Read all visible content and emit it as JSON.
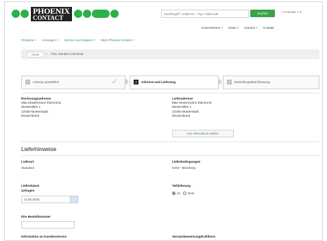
{
  "header": {
    "brand_line1": "PHOENIX",
    "brand_line2": "CONTACT",
    "search_placeholder": "Suchbegriff / Artikel-Nr. / Typ / Webcode",
    "search_button": "Suchen",
    "product_link": "> Produkte A-Z",
    "colors": {
      "brand_green": "#2bb04a",
      "accent_green": "#3da24a"
    }
  },
  "subnav": [
    "Unternehmen",
    "News",
    "Karriere",
    "Kontakt"
  ],
  "mainnav": [
    "Produkte",
    "Lösungen",
    "Service und Support",
    "Mein Phoenix Contact"
  ],
  "breadcrumb": {
    "home": "Home",
    "sep": ">",
    "current": "PxC Solution Checkout"
  },
  "steps": [
    {
      "num": "1",
      "label": "Lösung auswählen",
      "state": "done"
    },
    {
      "num": "2",
      "label": "Adresse und Lieferung",
      "state": "active"
    },
    {
      "num": "3",
      "label": "Bestellungsabschlüssung",
      "state": "pending"
    }
  ],
  "billing": {
    "title": "Rechnungsadresse",
    "lines": [
      "Max Mustermann Electronic",
      "Musterallee 1",
      "12345 Musterstadt",
      "Deutschland"
    ]
  },
  "shipping": {
    "title": "Lieferadresse",
    "lines": [
      "Max Mustermann Electronic",
      "Musterallee 1",
      "12345 Musterstadt",
      "Deutschland"
    ],
    "button": "Aus Adressbuch wählen"
  },
  "delivery": {
    "section_title": "Lieferhinweise",
    "lieferart_label": "Lieferart",
    "lieferart_value": "Standard",
    "bedingungen_label": "Lieferbedingungen",
    "bedingungen_value": "EXW - Blomberg",
    "datum_label_1": "Lieferdatum",
    "datum_label_2": "anfragen",
    "datum_value": "11.04.2018",
    "teil_label": "Teillieferung",
    "teil_yes": "Ja",
    "teil_no": "Nein",
    "bestell_label": "Ihre Bestellnummer",
    "bestell_value": "",
    "info_label": "Information an Kundenservice",
    "vers_label": "Versandanweisung/Kolliform"
  }
}
